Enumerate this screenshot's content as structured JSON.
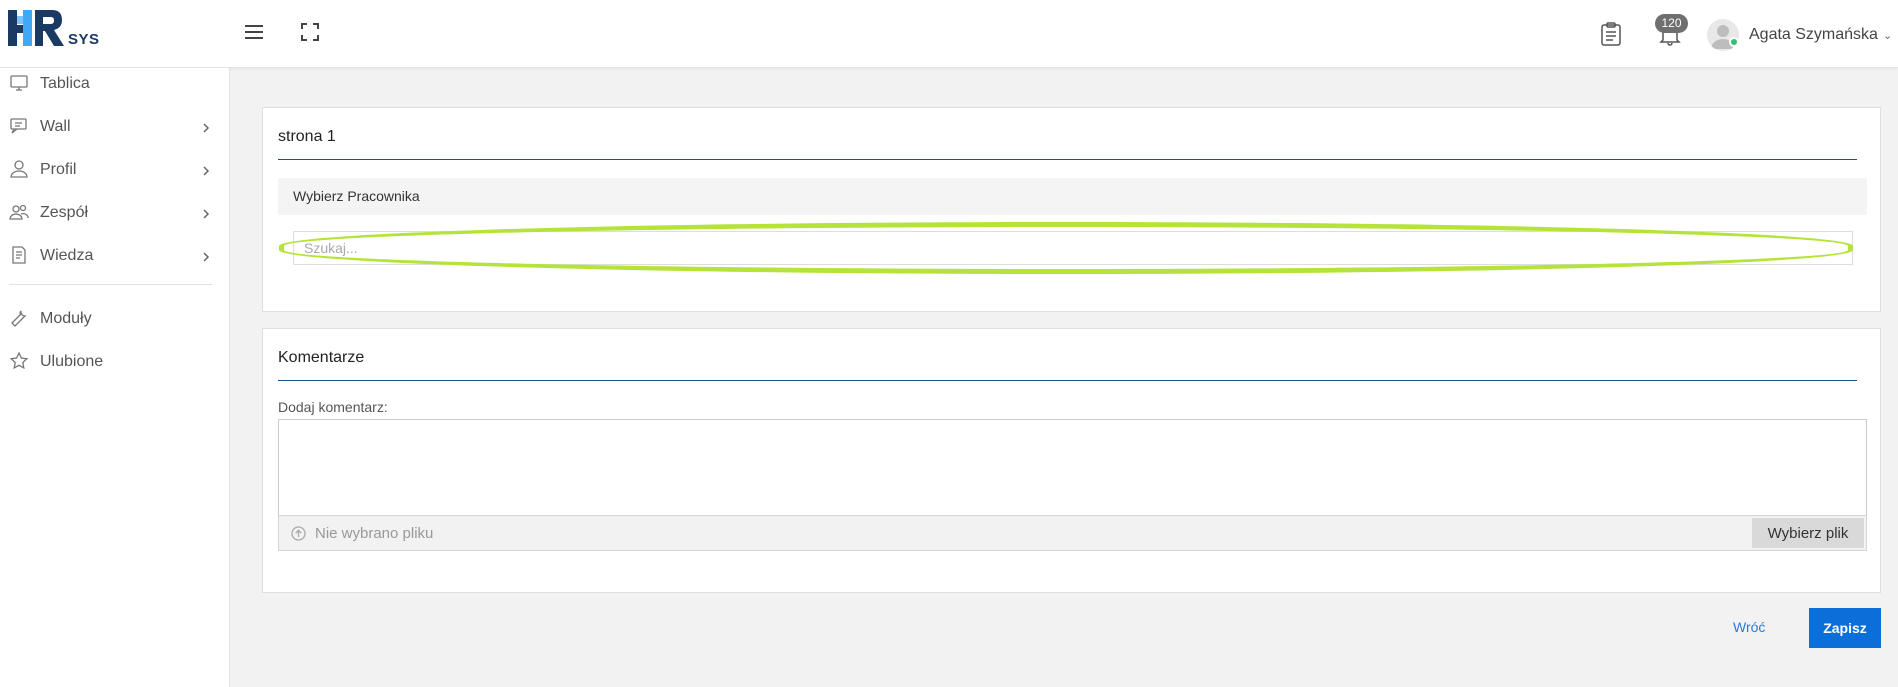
{
  "header": {
    "logo_text": "SYS",
    "notifications_count": "120",
    "user_name": "Agata Szymańska",
    "user_caret": "⌄"
  },
  "sidebar": {
    "items": [
      {
        "label": "Tablica",
        "icon": "monitor-icon"
      },
      {
        "label": "Wall",
        "icon": "chat-icon"
      },
      {
        "label": "Profil",
        "icon": "user-icon"
      },
      {
        "label": "Zespół",
        "icon": "team-icon"
      },
      {
        "label": "Wiedza",
        "icon": "document-icon"
      },
      {
        "label": "Moduły",
        "icon": "wrench-icon"
      },
      {
        "label": "Ulubione",
        "icon": "star-icon"
      }
    ]
  },
  "page_panel": {
    "title": "strona 1",
    "section_label": "Wybierz Pracownika",
    "search_placeholder": "Szukaj...",
    "highlight_color": "#b5e33a"
  },
  "comments_panel": {
    "title": "Komentarze",
    "field_label": "Dodaj komentarz:",
    "file_status": "Nie wybrano pliku",
    "choose_file_label": "Wybierz plik"
  },
  "actions": {
    "back_label": "Wróć",
    "save_label": "Zapisz"
  },
  "colors": {
    "accent": "#0a6fd8",
    "rule": "#1f4e8a",
    "status_online": "#2fbf71"
  }
}
